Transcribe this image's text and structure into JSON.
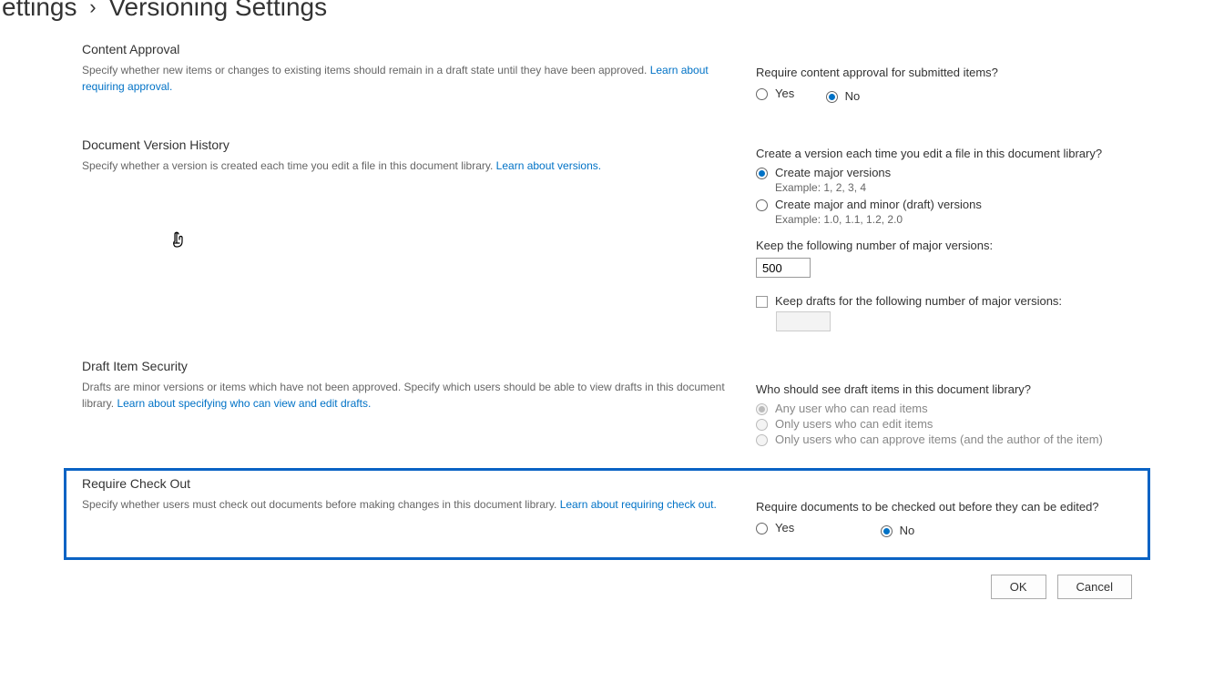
{
  "breadcrumb": {
    "prev_fragment": "ettings",
    "sep": "›",
    "current": "Versioning Settings"
  },
  "content_approval": {
    "title": "Content Approval",
    "desc": "Specify whether new items or changes to existing items should remain in a draft state until they have been approved.  ",
    "link": "Learn about requiring approval.",
    "question": "Require content approval for submitted items?",
    "yes": "Yes",
    "no": "No"
  },
  "version_history": {
    "title": "Document Version History",
    "desc": "Specify whether a version is created each time you edit a file in this document library.  ",
    "link": "Learn about versions.",
    "question": "Create a version each time you edit a file in this document library?",
    "opt_major": "Create major versions",
    "ex_major": "Example: 1, 2, 3, 4",
    "opt_minor": "Create major and minor (draft) versions",
    "ex_minor": "Example: 1.0, 1.1, 1.2, 2.0",
    "keep_major_label": "Keep the following number of major versions:",
    "keep_major_value": "500",
    "keep_drafts_label": "Keep drafts for the following number of major versions:",
    "keep_drafts_value": ""
  },
  "draft_security": {
    "title": "Draft Item Security",
    "desc": "Drafts are minor versions or items which have not been approved. Specify which users should be able to view drafts in this document library.  ",
    "link": "Learn about specifying who can view and edit drafts.",
    "question": "Who should see draft items in this document library?",
    "opt_any": "Any user who can read items",
    "opt_edit": "Only users who can edit items",
    "opt_approve": "Only users who can approve items (and the author of the item)"
  },
  "require_checkout": {
    "title": "Require Check Out",
    "desc": "Specify whether users must check out documents before making changes in this document library.  ",
    "link": "Learn about requiring check out.",
    "question": "Require documents to be checked out before they can be edited?",
    "yes": "Yes",
    "no": "No"
  },
  "buttons": {
    "ok": "OK",
    "cancel": "Cancel"
  }
}
